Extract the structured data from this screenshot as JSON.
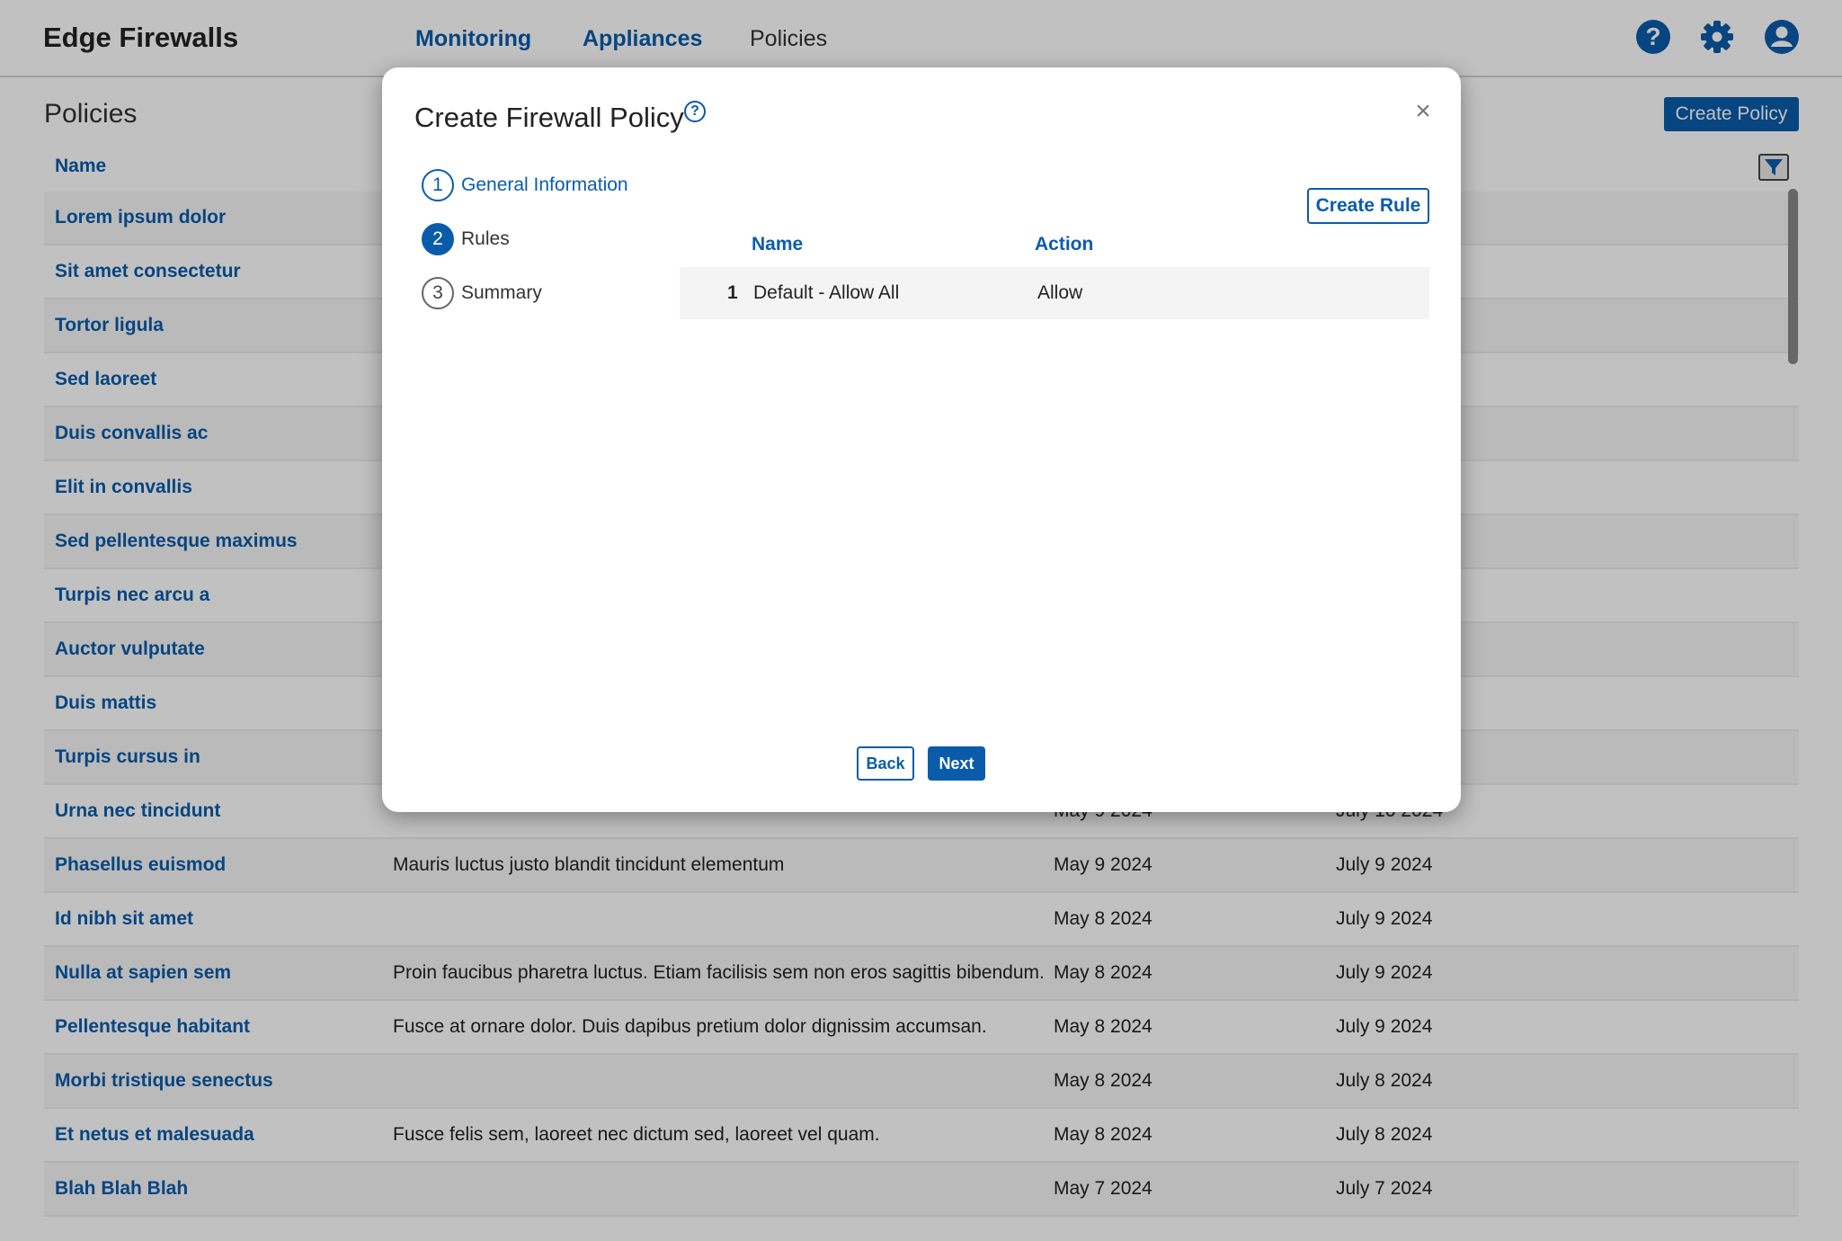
{
  "app": {
    "title": "Edge Firewalls"
  },
  "nav": {
    "monitoring": "Monitoring",
    "appliances": "Appliances",
    "policies": "Policies"
  },
  "icons": {
    "help": "help-icon",
    "settings": "gear-icon",
    "user": "user-icon",
    "filter": "filter-icon",
    "close": "close-icon"
  },
  "page": {
    "title": "Policies",
    "create_policy_label": "Create Policy",
    "column_name": "Name"
  },
  "table": {
    "rows": [
      {
        "name": "Lorem ipsum dolor",
        "description": "",
        "created": "",
        "modified": ""
      },
      {
        "name": "Sit amet consectetur",
        "description": "",
        "created": "",
        "modified": ""
      },
      {
        "name": "Tortor ligula",
        "description": "",
        "created": "",
        "modified": ""
      },
      {
        "name": "Sed laoreet",
        "description": "",
        "created": "",
        "modified": ""
      },
      {
        "name": "Duis convallis ac",
        "description": "",
        "created": "",
        "modified": ""
      },
      {
        "name": "Elit in  convallis",
        "description": "",
        "created": "",
        "modified": ""
      },
      {
        "name": "Sed pellentesque maximus",
        "description": "",
        "created": "",
        "modified": ""
      },
      {
        "name": "Turpis nec arcu a",
        "description": "",
        "created": "",
        "modified": ""
      },
      {
        "name": "Auctor vulputate",
        "description": "",
        "created": "",
        "modified": ""
      },
      {
        "name": "Duis mattis",
        "description": "",
        "created": "",
        "modified": ""
      },
      {
        "name": "Turpis cursus in",
        "description": "",
        "created": "",
        "modified": ""
      },
      {
        "name": "Urna nec tincidunt",
        "description": "",
        "created": "May 9 2024",
        "modified": "July 10 2024"
      },
      {
        "name": "Phasellus euismod",
        "description": "Mauris luctus justo blandit tincidunt elementum",
        "created": "May 9 2024",
        "modified": "July 9 2024"
      },
      {
        "name": "Id nibh sit amet",
        "description": "",
        "created": "May 8 2024",
        "modified": "July 9 2024"
      },
      {
        "name": "Nulla at sapien sem",
        "description": "Proin faucibus pharetra luctus. Etiam facilisis sem non eros sagittis bibendum.",
        "created": "May 8 2024",
        "modified": "July 9 2024"
      },
      {
        "name": "Pellentesque habitant",
        "description": "Fusce at ornare dolor. Duis dapibus pretium dolor dignissim accumsan.",
        "created": "May 8 2024",
        "modified": "July 9 2024"
      },
      {
        "name": "Morbi tristique senectus",
        "description": "",
        "created": "May 8 2024",
        "modified": "July 8 2024"
      },
      {
        "name": "Et netus et malesuada",
        "description": "Fusce felis sem, laoreet nec dictum sed, laoreet vel quam.",
        "created": "May 8 2024",
        "modified": "July 8 2024"
      },
      {
        "name": "Blah Blah Blah",
        "description": "",
        "created": "May 7 2024",
        "modified": "July 7 2024"
      }
    ]
  },
  "modal": {
    "title": "Create Firewall Policy",
    "help_glyph": "?",
    "close_glyph": "×",
    "steps": [
      {
        "number": "1",
        "label": "General Information",
        "state": "done"
      },
      {
        "number": "2",
        "label": "Rules",
        "state": "current"
      },
      {
        "number": "3",
        "label": "Summary",
        "state": "pending"
      }
    ],
    "create_rule_label": "Create Rule",
    "rules_columns": {
      "name": "Name",
      "action": "Action"
    },
    "rules": [
      {
        "number": "1",
        "name": "Default - Allow All",
        "action": "Allow"
      }
    ],
    "back_label": "Back",
    "next_label": "Next"
  },
  "colors": {
    "accent": "#0a5cab",
    "overlay": "rgba(0,0,0,0.245)"
  }
}
